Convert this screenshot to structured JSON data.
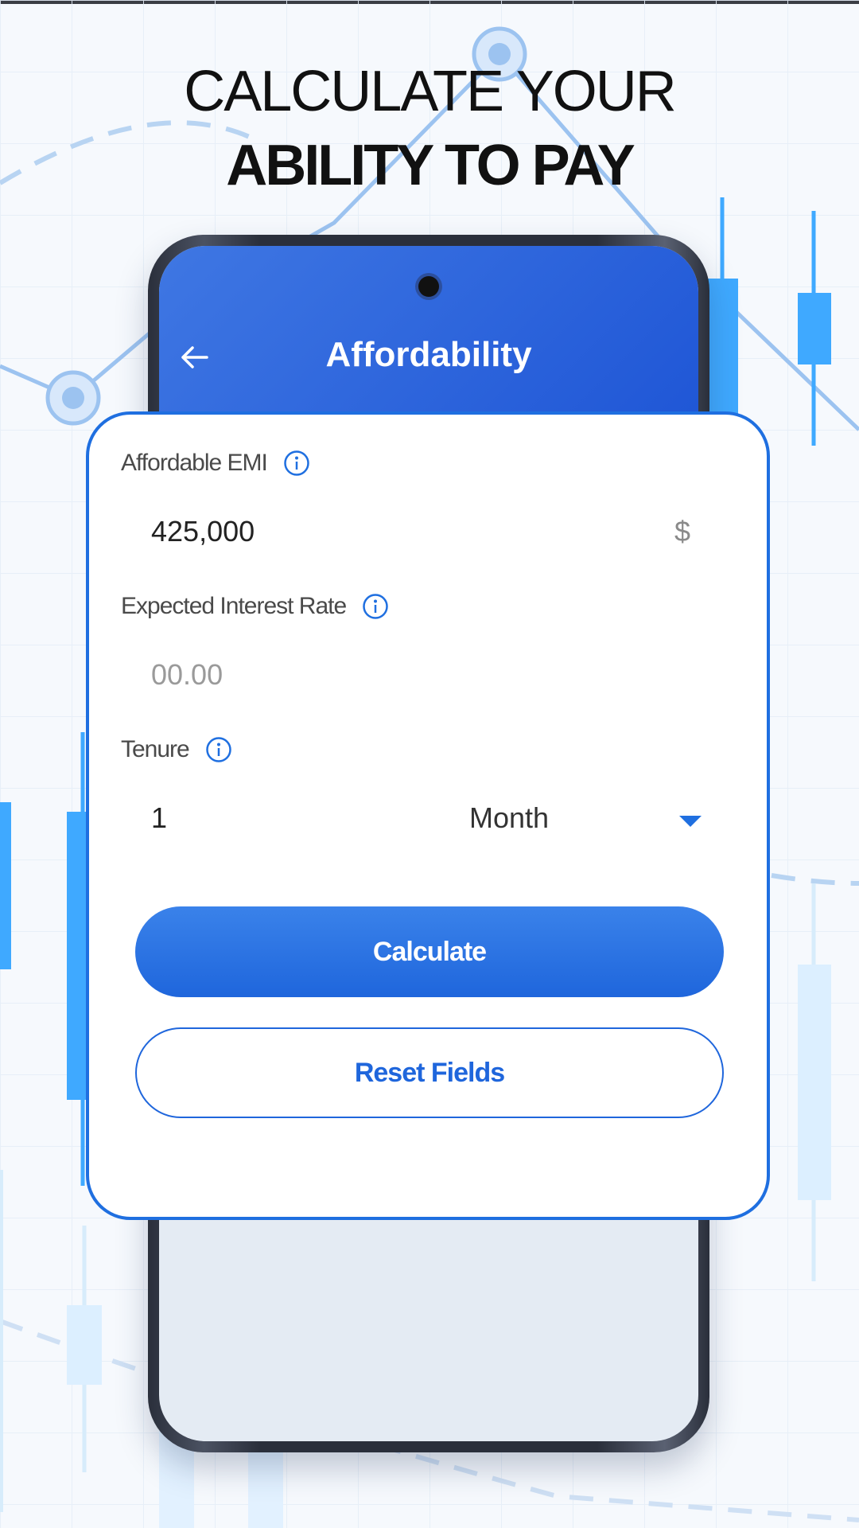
{
  "headline": {
    "line1": "CALCULATE YOUR",
    "line2": "ABILITY TO PAY"
  },
  "app": {
    "title": "Affordability",
    "back_icon": "arrow-left-icon"
  },
  "form": {
    "emi": {
      "label": "Affordable EMI",
      "value": "425,000",
      "currency": "$",
      "icon": "info-icon"
    },
    "interest": {
      "label": "Expected Interest Rate",
      "placeholder": "00.00",
      "icon": "info-icon"
    },
    "tenure": {
      "label": "Tenure",
      "value": "1",
      "unit": "Month",
      "icon": "info-icon"
    }
  },
  "buttons": {
    "calculate": "Calculate",
    "reset": "Reset Fields"
  },
  "colors": {
    "accent": "#1f6fe0",
    "header_gradient_start": "#3f77e3",
    "header_gradient_end": "#1f56d6"
  }
}
